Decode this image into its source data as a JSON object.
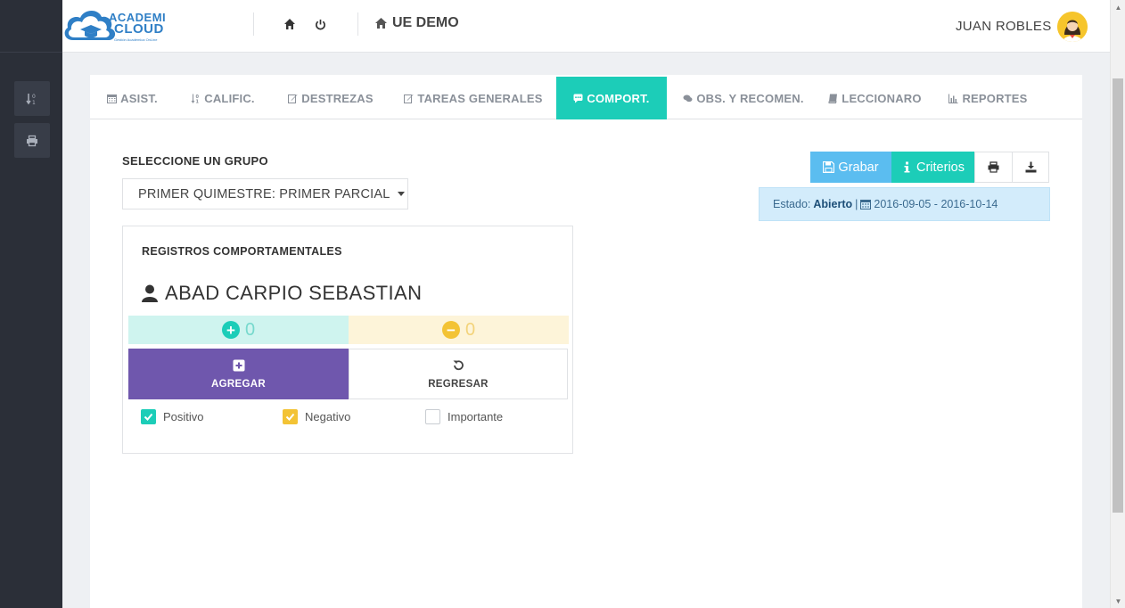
{
  "app": {
    "logo_line1": "ACADEMI",
    "logo_line2": "CLOUD",
    "logo_tagline": "Gestión Académica OnLine",
    "school": "UE DEMO",
    "user_name": "JUAN ROBLES"
  },
  "sidebar": {
    "items": [
      {
        "icon": "sort-numeric-icon"
      },
      {
        "icon": "print-icon"
      }
    ]
  },
  "tabs": [
    {
      "label": "ASIST.",
      "icon": "calendar-icon",
      "active": false
    },
    {
      "label": "CALIFIC.",
      "icon": "sort-numeric-icon",
      "active": false
    },
    {
      "label": "DESTREZAS",
      "icon": "edit-icon",
      "active": false
    },
    {
      "label": "TAREAS GENERALES",
      "icon": "edit-icon",
      "active": false
    },
    {
      "label": "COMPORT.",
      "icon": "comment-icon",
      "active": true
    },
    {
      "label": "OBS. Y RECOMEN.",
      "icon": "comments-icon",
      "active": false
    },
    {
      "label": "LECCIONARO",
      "icon": "book-icon",
      "active": false
    },
    {
      "label": "REPORTES",
      "icon": "bar-chart-icon",
      "active": false
    }
  ],
  "group": {
    "label": "SELECCIONE UN GRUPO",
    "selected": "PRIMER QUIMESTRE: PRIMER PARCIAL"
  },
  "registros": {
    "title": "REGISTROS COMPORTAMENTALES",
    "student": "ABAD CARPIO SEBASTIAN",
    "positive_count": "0",
    "negative_count": "0",
    "add_label": "AGREGAR",
    "back_label": "REGRESAR",
    "checkboxes": [
      {
        "label": "Positivo",
        "checked": true,
        "color": "#1ccdb8"
      },
      {
        "label": "Negativo",
        "checked": true,
        "color": "#f3c335"
      },
      {
        "label": "Importante",
        "checked": false
      }
    ]
  },
  "toolbar": {
    "grabar_label": "Grabar",
    "criterios_label": "Criterios"
  },
  "status": {
    "prefix": "Estado:",
    "value": "Abierto",
    "separator": "|",
    "dates": "2016-09-05 - 2016-10-14"
  },
  "colors": {
    "accent": "#1ccdb8",
    "purple": "#6f57ad",
    "blue": "#5bbdf0",
    "yellow": "#f3c335",
    "sidebar": "#2b2f38"
  }
}
